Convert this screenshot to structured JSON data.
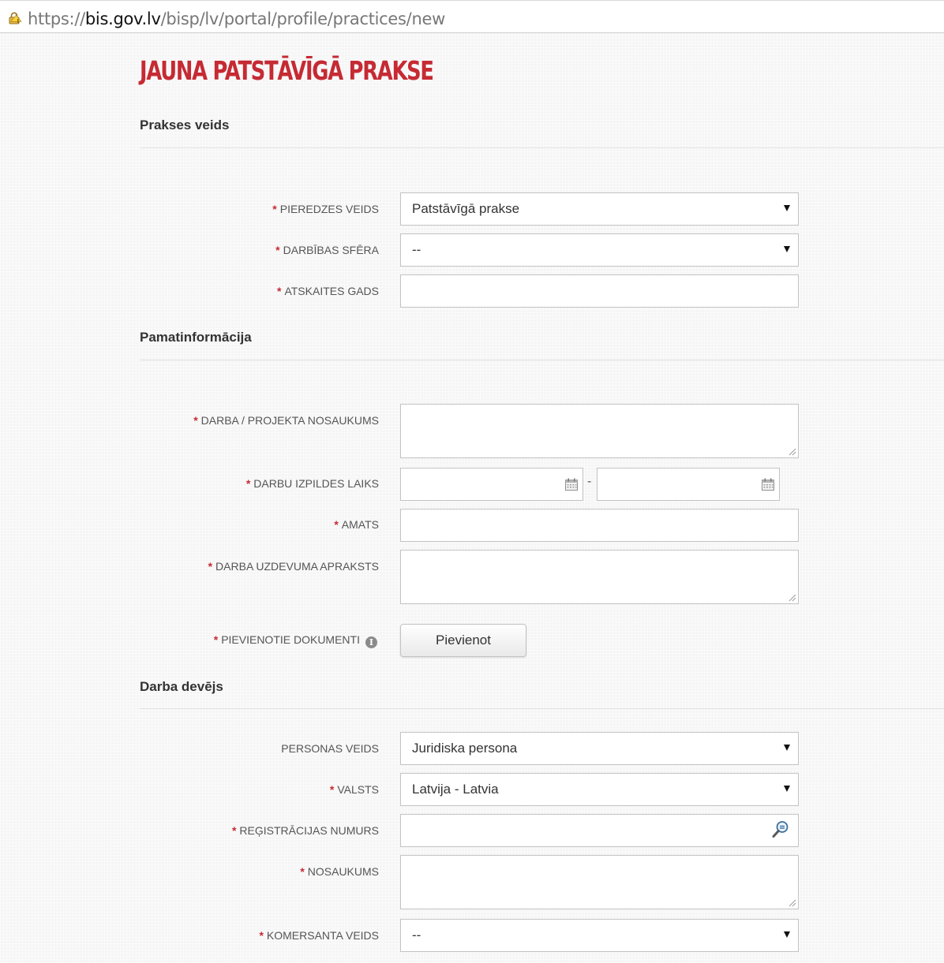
{
  "browser": {
    "url_scheme": "https://",
    "url_host": "bis.gov.lv",
    "url_path": "/bisp/lv/portal/profile/practices/new",
    "lock_icon": "warning-lock-icon"
  },
  "page": {
    "title": "Jauna patstāvīgā prakse"
  },
  "sections": {
    "practice_type": "Prakses veids",
    "basic_info": "Pamatinformācija",
    "employer": "Darba devējs"
  },
  "colors": {
    "accent": "#c62a33",
    "required_marker": "#c62a33"
  },
  "required_marker": "*",
  "fields": {
    "experience_type": {
      "label": "Pieredzes veids",
      "value": "Patstāvīgā prakse",
      "required": true
    },
    "activity_sphere": {
      "label": "Darbības sfēra",
      "value": "--",
      "required": true
    },
    "report_year": {
      "label": "Atskaites gads",
      "value": "",
      "required": true
    },
    "project_name": {
      "label": "Darba / projekta nosaukums",
      "value": "",
      "required": true
    },
    "execution_time": {
      "label": "Darbu izpildes laiks",
      "from": "",
      "to": "",
      "separator": "-",
      "required": true
    },
    "position": {
      "label": "Amats",
      "value": "",
      "required": true
    },
    "task_description": {
      "label": "Darba uzdevuma apraksts",
      "value": "",
      "required": true
    },
    "attached_documents": {
      "label": "Pievienotie dokumenti",
      "button_label": "Pievienot",
      "info_icon": "info-icon",
      "required": true
    },
    "person_type": {
      "label": "Personas veids",
      "value": "Juridiska persona",
      "required": false
    },
    "country": {
      "label": "Valsts",
      "value": "Latvija - Latvia",
      "required": true
    },
    "registration_number": {
      "label": "Reģistrācijas numurs",
      "value": "",
      "search_icon": "search-icon",
      "required": true
    },
    "name": {
      "label": "Nosaukums",
      "value": "",
      "required": true
    },
    "merchant_type": {
      "label": "Komersanta veids",
      "value": "--",
      "required": true
    }
  }
}
